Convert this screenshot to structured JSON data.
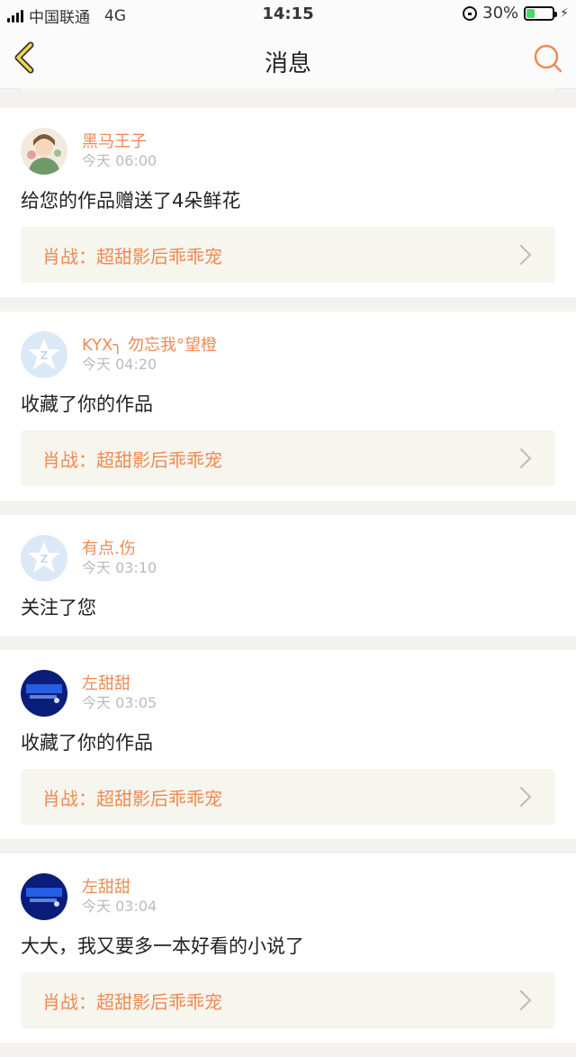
{
  "status": {
    "carrier": "中国联通",
    "network": "4G",
    "time": "14:15",
    "battery": "30%"
  },
  "header": {
    "title": "消息"
  },
  "messages": [
    {
      "avatar": "cartoon-girl-avatar",
      "name": "黑马王子",
      "time": "今天 06:00",
      "text": "给您的作品赠送了4朵鲜花",
      "work": "肖战：超甜影后乖乖宠"
    },
    {
      "avatar": "default-qq-avatar",
      "name": "KYX╮ 勿忘我°望橙",
      "time": "今天 04:20",
      "text": "收藏了你的作品",
      "work": "肖战：超甜影后乖乖宠"
    },
    {
      "avatar": "default-qq-avatar",
      "name": "有点.伤",
      "time": "今天 03:10",
      "text": "关注了您",
      "work": ""
    },
    {
      "avatar": "blue-neon-avatar",
      "name": "左甜甜",
      "time": "今天 03:05",
      "text": "收藏了你的作品",
      "work": "肖战：超甜影后乖乖宠"
    },
    {
      "avatar": "blue-neon-avatar",
      "name": "左甜甜",
      "time": "今天 03:04",
      "text": "大大，我又要多一本好看的小说了",
      "work": "肖战：超甜影后乖乖宠"
    }
  ],
  "colors": {
    "accent": "#ee8a55",
    "work_bg": "#f6f5ee",
    "page_bg": "#f4f2ef"
  }
}
